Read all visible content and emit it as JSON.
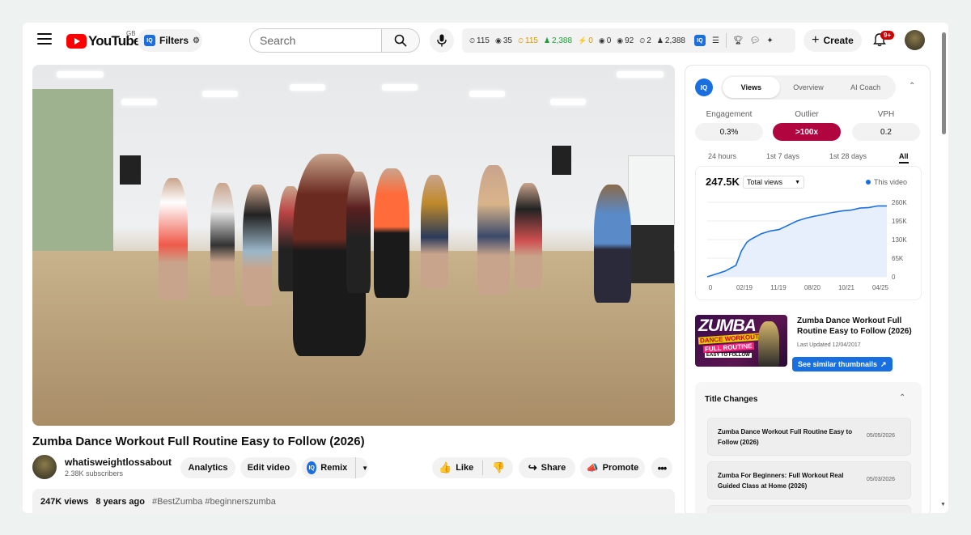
{
  "header": {
    "logo_text": "YouTube",
    "region": "GB",
    "filters_label": "Filters",
    "iq_badge": "IQ",
    "search_placeholder": "Search",
    "stats": [
      {
        "icon": "⏲",
        "value": "115",
        "color": "#333333"
      },
      {
        "icon": "◉",
        "value": "35",
        "color": "#333333"
      },
      {
        "icon": "⏲",
        "value": "115",
        "color": "#d99a00"
      },
      {
        "icon": "♟",
        "value": "2,388",
        "color": "#1e9e3a"
      },
      {
        "icon": "⚡",
        "value": "0",
        "color": "#d99a00"
      },
      {
        "icon": "◉",
        "value": "0",
        "color": "#333333"
      },
      {
        "icon": "◉",
        "value": "92",
        "color": "#333333"
      },
      {
        "icon": "⏲",
        "value": "2",
        "color": "#333333"
      },
      {
        "icon": "♟",
        "value": "2,388",
        "color": "#333333"
      }
    ],
    "create_label": "Create",
    "notifications": "9+"
  },
  "video": {
    "title": "Zumba Dance Workout Full Routine Easy to Follow (2026)",
    "channel": "whatisweightlossabout",
    "subscribers": "2.38K subscribers",
    "buttons": {
      "analytics": "Analytics",
      "edit": "Edit video",
      "remix": "Remix",
      "like": "Like",
      "share": "Share",
      "promote": "Promote"
    },
    "views": "247K views",
    "age": "8 years ago",
    "tags": "#BestZumba #beginnerszumba"
  },
  "panel": {
    "logo": "IQ",
    "tabs": [
      {
        "label": "Views",
        "active": true
      },
      {
        "label": "Overview",
        "active": false
      },
      {
        "label": "AI Coach",
        "active": false
      }
    ],
    "metrics": [
      {
        "label": "Engagement",
        "value": "0.3%"
      },
      {
        "label": "Outlier",
        "value": ">100x"
      },
      {
        "label": "VPH",
        "value": "0.2"
      }
    ],
    "ranges": [
      {
        "label": "24 hours",
        "active": false
      },
      {
        "label": "1st 7 days",
        "active": false
      },
      {
        "label": "1st 28 days",
        "active": false
      },
      {
        "label": "All",
        "active": true
      }
    ],
    "total": "247.5K",
    "select_value": "Total views",
    "legend": "This video",
    "thumb_title": "Zumba Dance Workout Full Routine Easy to Follow (2026)",
    "thumb_updated": "Last Updated 12/04/2017",
    "thumb_text": {
      "big": "ZUMBA",
      "line1": "DANCE WORKOUT",
      "line2": "FULL ROUTINE",
      "line3": "EASY TO FOLLOW"
    },
    "similar_label": "See similar thumbnails",
    "title_changes_header": "Title Changes",
    "title_changes": [
      {
        "title": "Zumba Dance Workout Full Routine Easy to Follow (2026)",
        "date": "05/05/2026"
      },
      {
        "title": "Zumba For Beginners: Full Workout Real Guided Class at Home (2026)",
        "date": "05/03/2026"
      }
    ]
  },
  "chart_data": {
    "type": "area",
    "title": "",
    "x_tick_labels": [
      "0",
      "02/19",
      "11/19",
      "08/20",
      "10/21",
      "04/25"
    ],
    "y_tick_labels": [
      "260K",
      "195K",
      "130K",
      "65K",
      "0"
    ],
    "ylim": [
      0,
      260000
    ],
    "series": [
      {
        "name": "This video",
        "color": "#1a6fe0",
        "x": [
          0,
          0.05,
          0.1,
          0.16,
          0.19,
          0.22,
          0.24,
          0.27,
          0.3,
          0.35,
          0.4,
          0.45,
          0.5,
          0.55,
          0.6,
          0.65,
          0.7,
          0.75,
          0.8,
          0.85,
          0.9,
          0.95,
          1.0
        ],
        "values": [
          0,
          10000,
          20000,
          40000,
          90000,
          120000,
          130000,
          140000,
          150000,
          160000,
          165000,
          180000,
          195000,
          205000,
          212000,
          218000,
          225000,
          230000,
          233000,
          240000,
          242000,
          247500,
          247500
        ]
      }
    ],
    "grid": true
  }
}
